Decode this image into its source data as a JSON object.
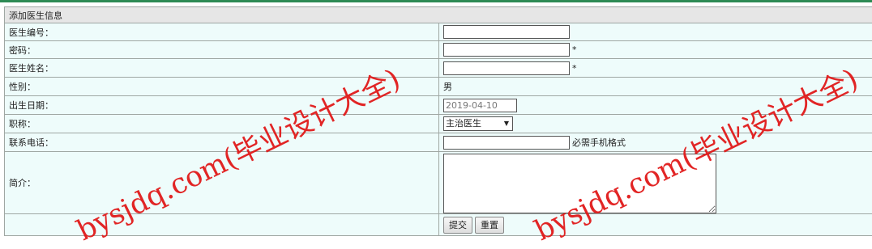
{
  "form": {
    "title": "添加医生信息",
    "fields": {
      "doctor_id": {
        "label": "医生编号：",
        "value": ""
      },
      "password": {
        "label": "密码：",
        "value": "",
        "required_mark": "*"
      },
      "name": {
        "label": "医生姓名：",
        "value": "",
        "required_mark": "*"
      },
      "gender": {
        "label": "性别：",
        "value": "男"
      },
      "birthdate": {
        "label": "出生日期：",
        "value": "2019-04-10"
      },
      "title": {
        "label": "职称：",
        "selected": "主治医生"
      },
      "phone": {
        "label": "联系电话：",
        "value": "",
        "hint": "必需手机格式"
      },
      "intro": {
        "label": "简介：",
        "value": ""
      }
    },
    "buttons": {
      "submit": "提交",
      "reset": "重置"
    }
  },
  "watermark": {
    "text": "bysjdq.com(毕业设计大全)"
  }
}
